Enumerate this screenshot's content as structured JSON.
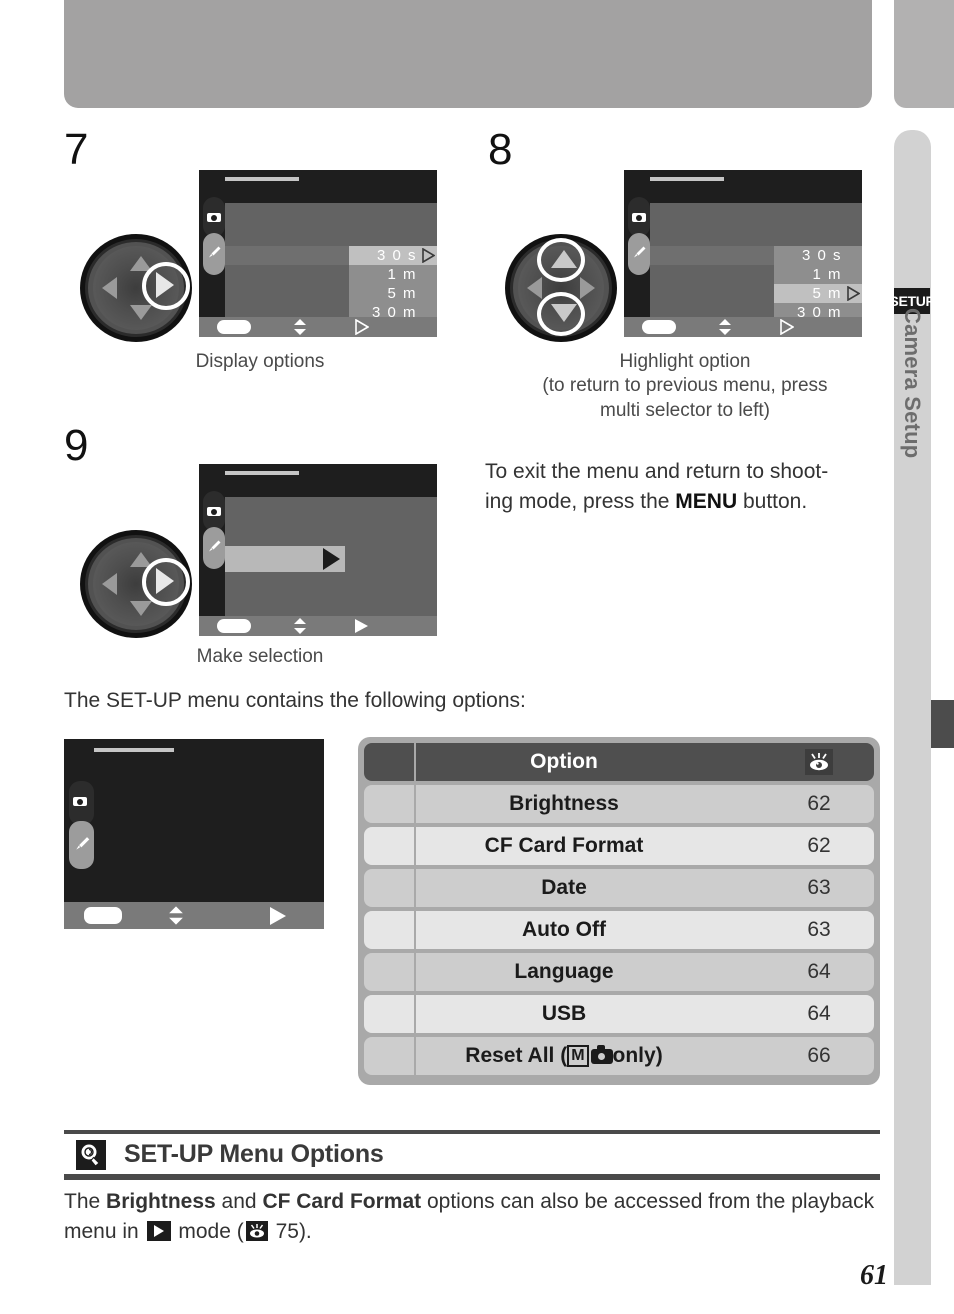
{
  "page": {
    "number": "61",
    "sidebar": {
      "badge": "SETUP",
      "vertical_label": "Camera Setup"
    }
  },
  "steps": [
    {
      "number": "7",
      "caption": "Display options",
      "dial_highlight": "right",
      "screen": {
        "options": [
          "3 0 s",
          "1 m",
          "5 m",
          "3 0 m"
        ],
        "highlighted_index": 0
      }
    },
    {
      "number": "8",
      "caption_line1": "Highlight option",
      "caption_line2": "(to return to previous menu, press",
      "caption_line3": "multi selector to left)",
      "dial_highlight": "up-down",
      "screen": {
        "options": [
          "3 0 s",
          "1 m",
          "5 m",
          "3 0 m"
        ],
        "highlighted_index": 2
      }
    },
    {
      "number": "9",
      "caption": "Make selection",
      "dial_highlight": "right",
      "screen": {
        "selection_row": true
      }
    }
  ],
  "exit_note": {
    "line1": "To exit the menu and return to shoot-",
    "line2_pre": "ing mode, press the ",
    "line2_strong": "MENU",
    "line2_post": " button."
  },
  "intro_text": "The SET-UP menu contains the following options:",
  "table": {
    "header": {
      "option": "Option",
      "page_icon": "eye-reference-icon"
    },
    "rows": [
      {
        "option": "Brightness",
        "page": "62"
      },
      {
        "option": "CF Card Format",
        "page": "62"
      },
      {
        "option": "Date",
        "page": "63"
      },
      {
        "option": "Auto Off",
        "page": "63"
      },
      {
        "option": "Language",
        "page": "64"
      },
      {
        "option": "USB",
        "page": "64"
      },
      {
        "option_pre": "Reset All (",
        "option_mode": "M",
        "option_post": " only)",
        "page": "66"
      }
    ]
  },
  "note": {
    "icon": "tip-lightbulb-icon",
    "title": "SET-UP Menu Options",
    "body_1": "The ",
    "body_b1": "Brightness",
    "body_2": " and ",
    "body_b2": "CF Card Format",
    "body_3": " options can also be accessed from the",
    "body_4": "playback menu in ",
    "body_5": " mode (",
    "body_6": " 75)."
  },
  "colors": {
    "banner": "#a3a2a2",
    "rail": "#d2d2d2",
    "rail_marker": "#4c4c4c",
    "table_header": "#4f4f4f",
    "table_band_a": "#cdcdcd",
    "table_band_b": "#e6e6e6",
    "lcd_dark": "#1e1e1e",
    "lcd_body": "#636363"
  }
}
